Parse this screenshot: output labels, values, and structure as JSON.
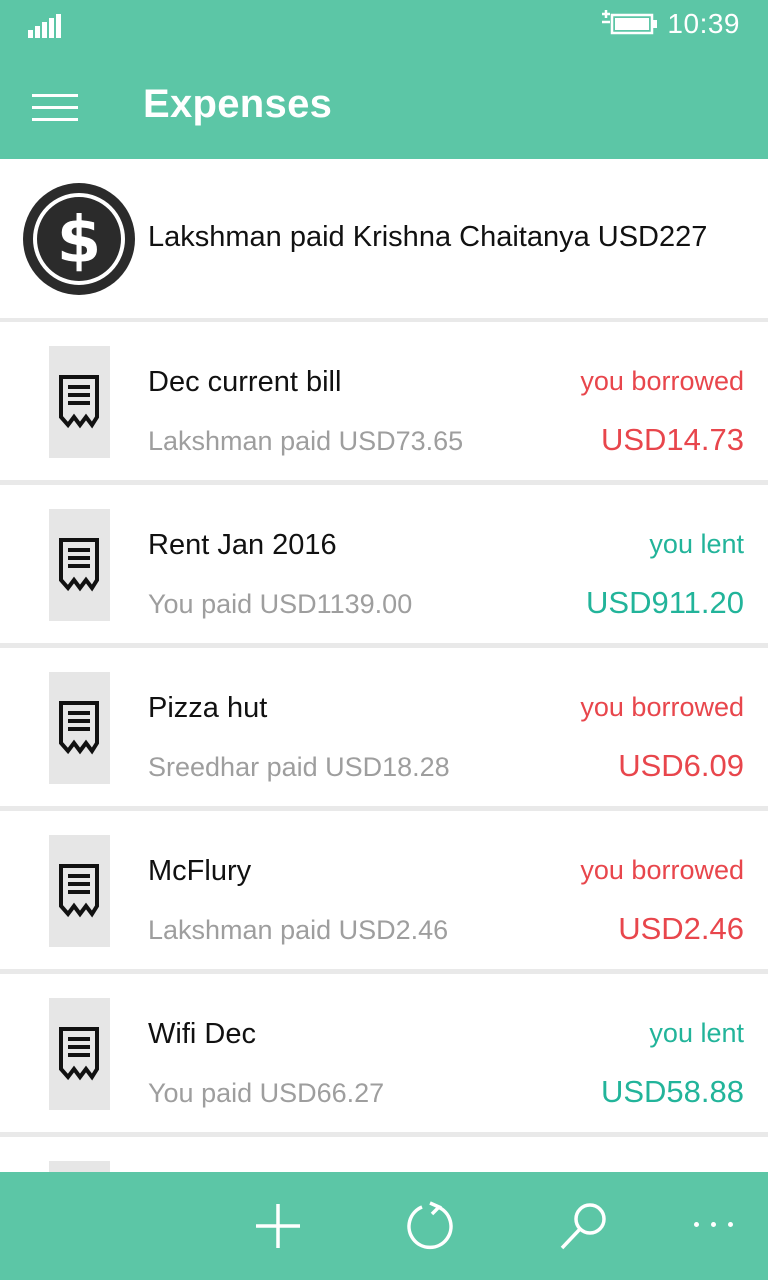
{
  "status_bar": {
    "time": "10:39"
  },
  "header": {
    "title": "Expenses"
  },
  "settlement": {
    "text": "Lakshman paid Krishna Chaitanya USD227"
  },
  "expenses": [
    {
      "title": "Dec current bill",
      "payer": "Lakshman paid USD73.65",
      "status": "you borrowed",
      "amount": "USD14.73",
      "color": "#e8464c"
    },
    {
      "title": "Rent Jan 2016",
      "payer": "You paid USD1139.00",
      "status": "you lent",
      "amount": "USD911.20",
      "color": "#22b49a"
    },
    {
      "title": "Pizza hut",
      "payer": "Sreedhar paid USD18.28",
      "status": "you borrowed",
      "amount": "USD6.09",
      "color": "#e8464c"
    },
    {
      "title": "McFlury",
      "payer": "Lakshman paid USD2.46",
      "status": "you borrowed",
      "amount": "USD2.46",
      "color": "#e8464c"
    },
    {
      "title": "Wifi Dec",
      "payer": "You paid USD66.27",
      "status": "you lent",
      "amount": "USD58.88",
      "color": "#22b49a"
    }
  ],
  "app_bar": {
    "icons": [
      "add-icon",
      "refresh-icon",
      "search-icon",
      "more-icon"
    ]
  },
  "colors": {
    "accent": "#5cc6a6",
    "borrowed": "#e8464c",
    "lent": "#22b49a"
  }
}
